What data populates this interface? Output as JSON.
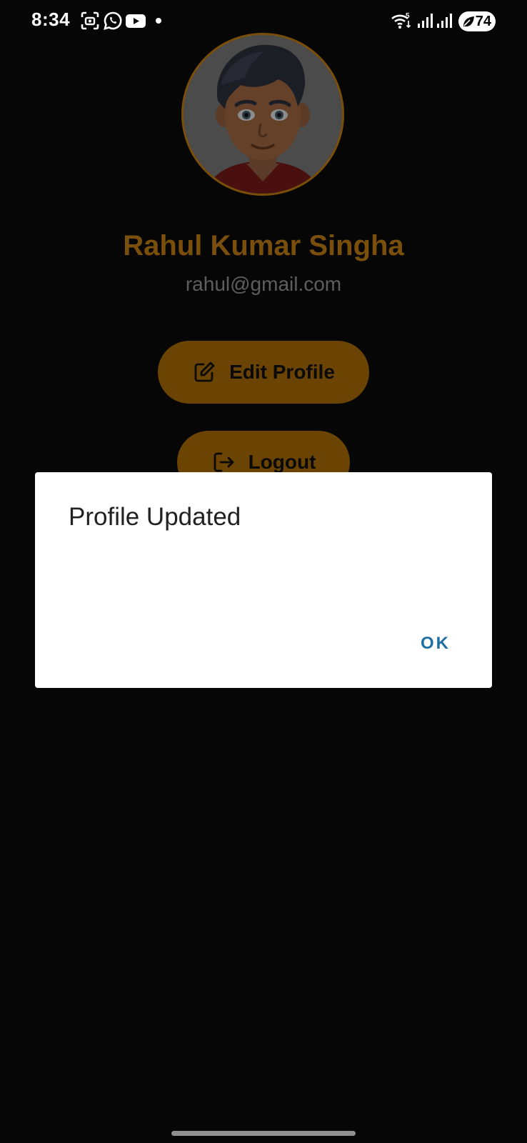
{
  "status_bar": {
    "time": "8:34",
    "battery": "74",
    "icons": [
      "screen-record-icon",
      "whatsapp-icon",
      "youtube-icon",
      "notification-dot",
      "wifi-icon",
      "signal-icon",
      "signal-icon",
      "battery-icon"
    ]
  },
  "profile": {
    "name": "Rahul Kumar Singha",
    "email": "rahul@gmail.com",
    "avatar_icon": "cartoon-boy-avatar"
  },
  "actions": {
    "edit_label": "Edit Profile",
    "edit_icon": "edit-icon",
    "logout_label": "Logout",
    "logout_icon": "logout-icon"
  },
  "dialog": {
    "title": "Profile Updated",
    "ok_label": "OK"
  },
  "colors": {
    "accent": "#9a6409",
    "background": "#060606",
    "dialog_background": "#ffffff",
    "dialog_button": "#1f6fa3"
  }
}
